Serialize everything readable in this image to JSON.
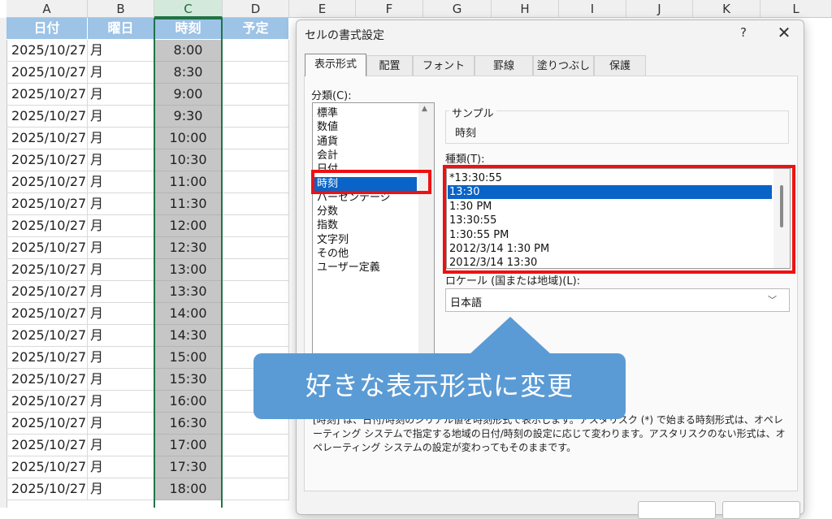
{
  "sheet": {
    "columns": [
      "A",
      "B",
      "C",
      "D",
      "E",
      "F",
      "G",
      "H",
      "I",
      "J",
      "K",
      "L"
    ],
    "header": {
      "date": "日付",
      "day": "曜日",
      "time": "時刻",
      "plan": "予定"
    },
    "rows": [
      {
        "date": "2025/10/27",
        "day": "月",
        "time": "8:00"
      },
      {
        "date": "2025/10/27",
        "day": "月",
        "time": "8:30"
      },
      {
        "date": "2025/10/27",
        "day": "月",
        "time": "9:00"
      },
      {
        "date": "2025/10/27",
        "day": "月",
        "time": "9:30"
      },
      {
        "date": "2025/10/27",
        "day": "月",
        "time": "10:00"
      },
      {
        "date": "2025/10/27",
        "day": "月",
        "time": "10:30"
      },
      {
        "date": "2025/10/27",
        "day": "月",
        "time": "11:00"
      },
      {
        "date": "2025/10/27",
        "day": "月",
        "time": "11:30"
      },
      {
        "date": "2025/10/27",
        "day": "月",
        "time": "12:00"
      },
      {
        "date": "2025/10/27",
        "day": "月",
        "time": "12:30"
      },
      {
        "date": "2025/10/27",
        "day": "月",
        "time": "13:00"
      },
      {
        "date": "2025/10/27",
        "day": "月",
        "time": "13:30"
      },
      {
        "date": "2025/10/27",
        "day": "月",
        "time": "14:00"
      },
      {
        "date": "2025/10/27",
        "day": "月",
        "time": "14:30"
      },
      {
        "date": "2025/10/27",
        "day": "月",
        "time": "15:00"
      },
      {
        "date": "2025/10/27",
        "day": "月",
        "time": "15:30"
      },
      {
        "date": "2025/10/27",
        "day": "月",
        "time": "16:00"
      },
      {
        "date": "2025/10/27",
        "day": "月",
        "time": "16:30"
      },
      {
        "date": "2025/10/27",
        "day": "月",
        "time": "17:00"
      },
      {
        "date": "2025/10/27",
        "day": "月",
        "time": "17:30"
      },
      {
        "date": "2025/10/27",
        "day": "月",
        "time": "18:00"
      }
    ]
  },
  "dialog": {
    "title": "セルの書式設定",
    "help": "?",
    "close": "✕",
    "tabs": [
      "表示形式",
      "配置",
      "フォント",
      "罫線",
      "塗りつぶし",
      "保護"
    ],
    "category_label": "分類(C):",
    "categories": [
      "標準",
      "数値",
      "通貨",
      "会計",
      "日付",
      "時刻",
      "パーセンテージ",
      "分数",
      "指数",
      "文字列",
      "その他",
      "ユーザー定義"
    ],
    "selected_category": "時刻",
    "sample_label": "サンプル",
    "sample_value": "時刻",
    "type_label": "種類(T):",
    "types": [
      "*13:30:55",
      "13:30",
      "1:30 PM",
      "13:30:55",
      "1:30:55 PM",
      "2012/3/14 1:30 PM",
      "2012/3/14 13:30"
    ],
    "selected_type": "13:30",
    "locale_label": "ロケール (国または地域)(L):",
    "locale_value": "日本語",
    "description": "[時刻] は、日付/時刻のシリアル値を時刻形式で表示します。アスタリスク (*) で始まる時刻形式は、オペレーティング システムで指定する地域の日付/時刻の設定に応じて変わります。アスタリスクのない形式は、オペレーティング システムの設定が変わってもそのままです。"
  },
  "callout": {
    "text": "好きな表示形式に変更"
  },
  "colors": {
    "highlight": "#ee1111",
    "callout": "#5b9bd5",
    "selection": "#0a64c8",
    "header_fill": "#9dc3e6"
  }
}
